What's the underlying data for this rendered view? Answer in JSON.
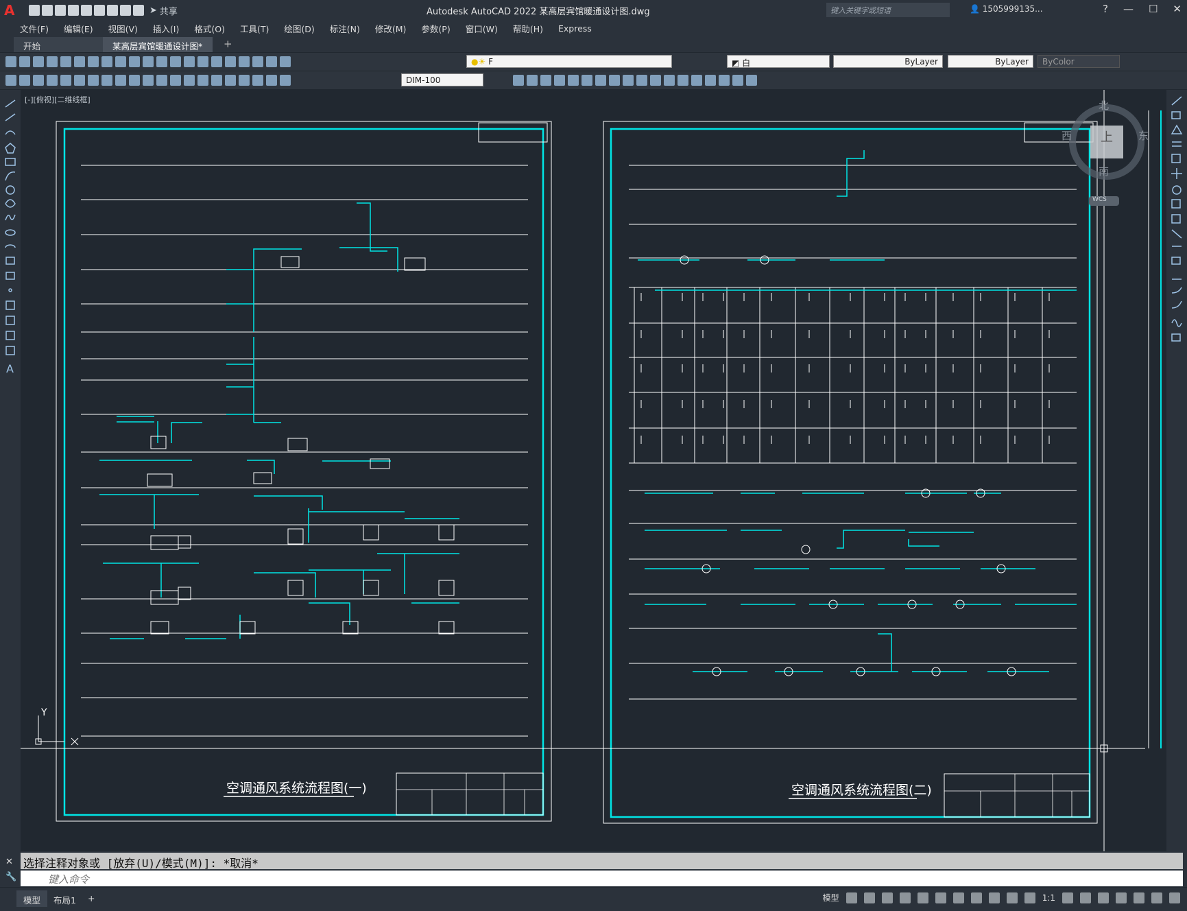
{
  "app": {
    "title": "Autodesk AutoCAD 2022    某高层宾馆暖通设计图.dwg",
    "share_label": "共享",
    "search_placeholder": "键入关键字或短语",
    "user": "1505999135...",
    "logo": "A"
  },
  "menu": [
    "文件(F)",
    "编辑(E)",
    "视图(V)",
    "插入(I)",
    "格式(O)",
    "工具(T)",
    "绘图(D)",
    "标注(N)",
    "修改(M)",
    "参数(P)",
    "窗口(W)",
    "帮助(H)",
    "Express"
  ],
  "tabs": {
    "start": "开始",
    "document": "某高层宾馆暖通设计图*"
  },
  "toolbar": {
    "layer_value": "F",
    "color_value": "白",
    "linetype_value": "ByLayer",
    "lineweight_value": "ByLayer",
    "plotstyle_value": "ByColor",
    "dimstyle_value": "DIM-100"
  },
  "viewport": {
    "label": "[-][俯视][二维线框]"
  },
  "viewcube": {
    "north": "北",
    "south": "南",
    "east": "东",
    "west": "西",
    "top": "上",
    "wcs": "WCS"
  },
  "drawing": {
    "sheet1_title": "空调通风系统流程图(一)",
    "sheet2_title": "空调通风系统流程图(二)",
    "ucs_y": "Y"
  },
  "command": {
    "history": "选择注释对象或 [放弃(U)/模式(M)]: *取消*",
    "placeholder": "键入命令"
  },
  "status": {
    "model_tab": "模型",
    "layout_tab": "布局1",
    "add": "+",
    "model_label": "模型",
    "scale": "1:1"
  },
  "colors": {
    "frame": "#00e5e5",
    "line": "#ffffff",
    "accent": "#cccc33",
    "background": "#212830"
  }
}
